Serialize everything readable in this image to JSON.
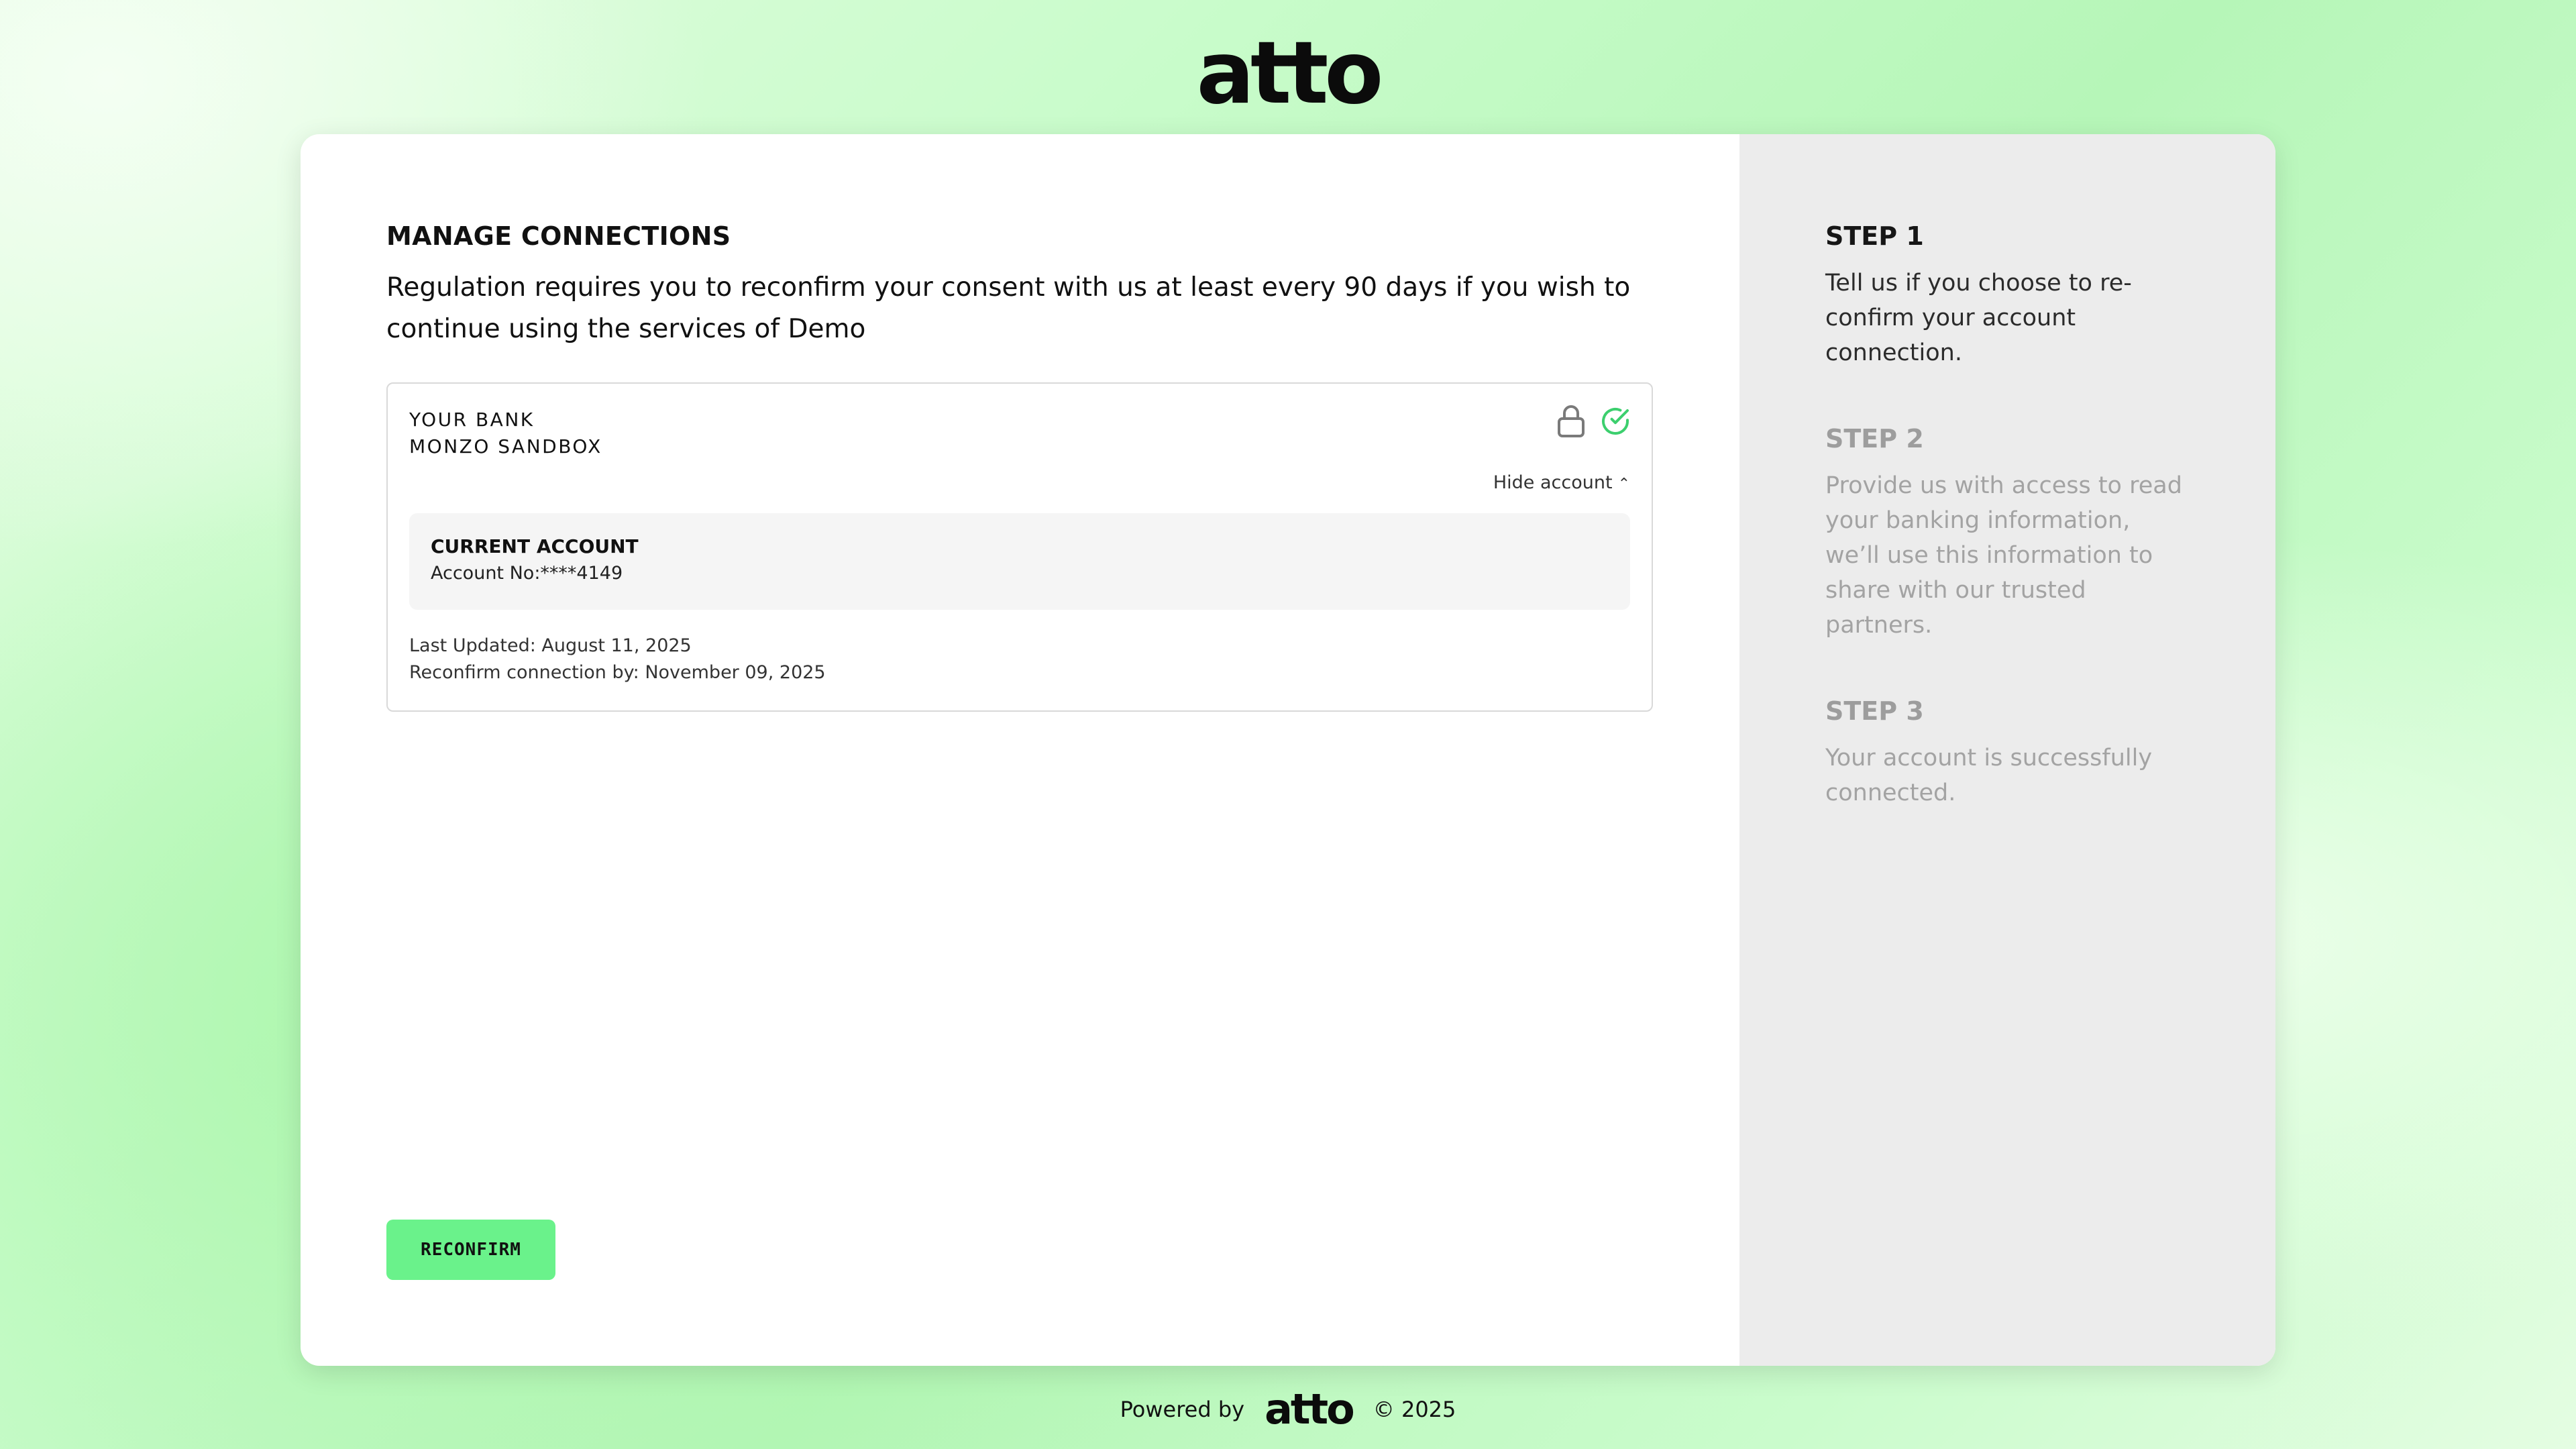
{
  "header": {
    "logo_text": "atto"
  },
  "main": {
    "title": "MANAGE CONNECTIONS",
    "intro": "Regulation requires you to reconfirm your consent with us at least every 90 days if you wish to continue using the services of Demo",
    "bank": {
      "label": "YOUR BANK",
      "name": "MONZO SANDBOX",
      "hide_account_label": "Hide account",
      "account": {
        "type": "CURRENT ACCOUNT",
        "number": "Account No:****4149"
      },
      "last_updated": "Last Updated: August 11, 2025",
      "reconfirm_by": "Reconfirm connection by: November 09, 2025"
    },
    "reconfirm_button": "RECONFIRM"
  },
  "steps": [
    {
      "title": "STEP 1",
      "text": "Tell us if you choose to re-confirm your account connection.",
      "state": "active"
    },
    {
      "title": "STEP 2",
      "text": "Provide us with access to read your banking information, we’ll use this information to share with our trusted partners.",
      "state": "inactive"
    },
    {
      "title": "STEP 3",
      "text": "Your account is successfully connected.",
      "state": "inactive"
    }
  ],
  "footer": {
    "powered_by": "Powered by",
    "logo_text": "atto",
    "copyright": "© 2025"
  },
  "colors": {
    "accent_button": "#6af28b",
    "check_icon": "#3ccf6e",
    "steps_panel_bg": "#ececec"
  }
}
